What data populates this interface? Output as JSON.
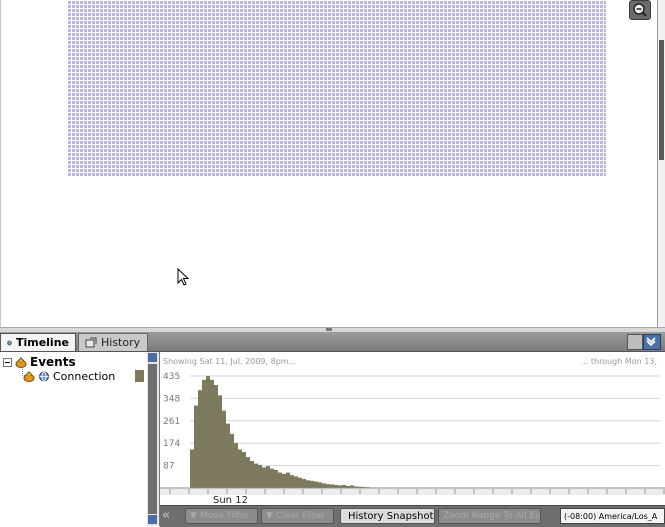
{
  "tabs": {
    "timeline_label": "Timeline",
    "history_label": "History"
  },
  "tree": {
    "root_label": "Events",
    "child_label": "Connection",
    "child_color": "#7d7a60"
  },
  "chart_header": {
    "left_text": "Showing Sat 11, Jul, 2009, 8pm...",
    "right_text": "... through Mon 13,"
  },
  "toolbar": {
    "move_filter_label": "Move Filter",
    "clear_filter_label": "Clear Filter",
    "history_snapshot_label": "History Snapshot",
    "zoom_to_all_label": "Zoom Range To All Events",
    "timezone_value": "(-08:00) America/Los_A"
  },
  "colors": {
    "bar": "#7d7a60",
    "grid_nodes": "#b7b3dc"
  },
  "chart_data": {
    "type": "bar",
    "title": "",
    "xlabel": "",
    "ylabel": "",
    "ylim": [
      0,
      435
    ],
    "yticks": [
      87,
      174,
      261,
      348,
      435
    ],
    "date_label": "Sun 12",
    "values": [
      150,
      320,
      380,
      420,
      435,
      420,
      400,
      360,
      300,
      250,
      210,
      175,
      150,
      140,
      120,
      105,
      95,
      90,
      80,
      85,
      75,
      70,
      60,
      55,
      60,
      50,
      45,
      40,
      35,
      30,
      28,
      25,
      22,
      18,
      15,
      14,
      12,
      10,
      12,
      8,
      10,
      6,
      5,
      4,
      3,
      2,
      2,
      1
    ],
    "series_color": "#7d7a60"
  }
}
